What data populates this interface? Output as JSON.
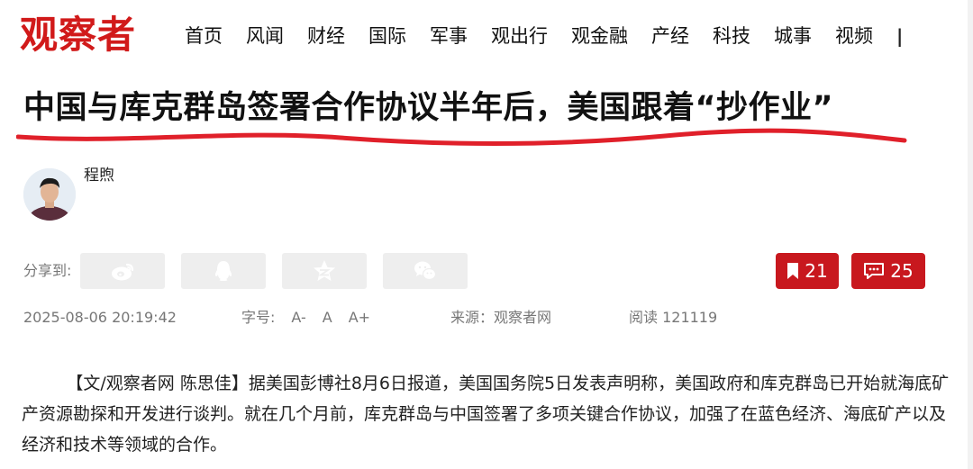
{
  "site": {
    "logo_text": "观察者",
    "brand_color": "#d11a1a"
  },
  "nav": {
    "items": [
      "首页",
      "风闻",
      "财经",
      "国际",
      "军事",
      "观出行",
      "观金融",
      "产经",
      "科技",
      "城事",
      "视频"
    ],
    "separator": "|"
  },
  "article": {
    "title": "中国与库克群岛签署合作协议半年后，美国跟着“抄作业”",
    "author": "程煦",
    "date": "2025-08-06 20:19:42",
    "font_size_label": "字号:",
    "font_sizes": [
      "A-",
      "A",
      "A+"
    ],
    "source": "来源：观察者网",
    "reads": "阅读 121119",
    "body": "【文/观察者网 陈思佳】据美国彭博社8月6日报道，美国国务院5日发表声明称，美国政府和库克群岛已开始就海底矿产资源勘探和开发进行谈判。就在几个月前，库克群岛与中国签署了多项关键合作协议，加强了在蓝色经济、海底矿产以及经济和技术等领域的合作。"
  },
  "share": {
    "label": "分享到:",
    "buttons": [
      "weibo-icon",
      "qq-icon",
      "qzone-icon",
      "wechat-icon"
    ]
  },
  "counts": {
    "bookmark": "21",
    "comments": "25",
    "accent": "#c8181e"
  }
}
